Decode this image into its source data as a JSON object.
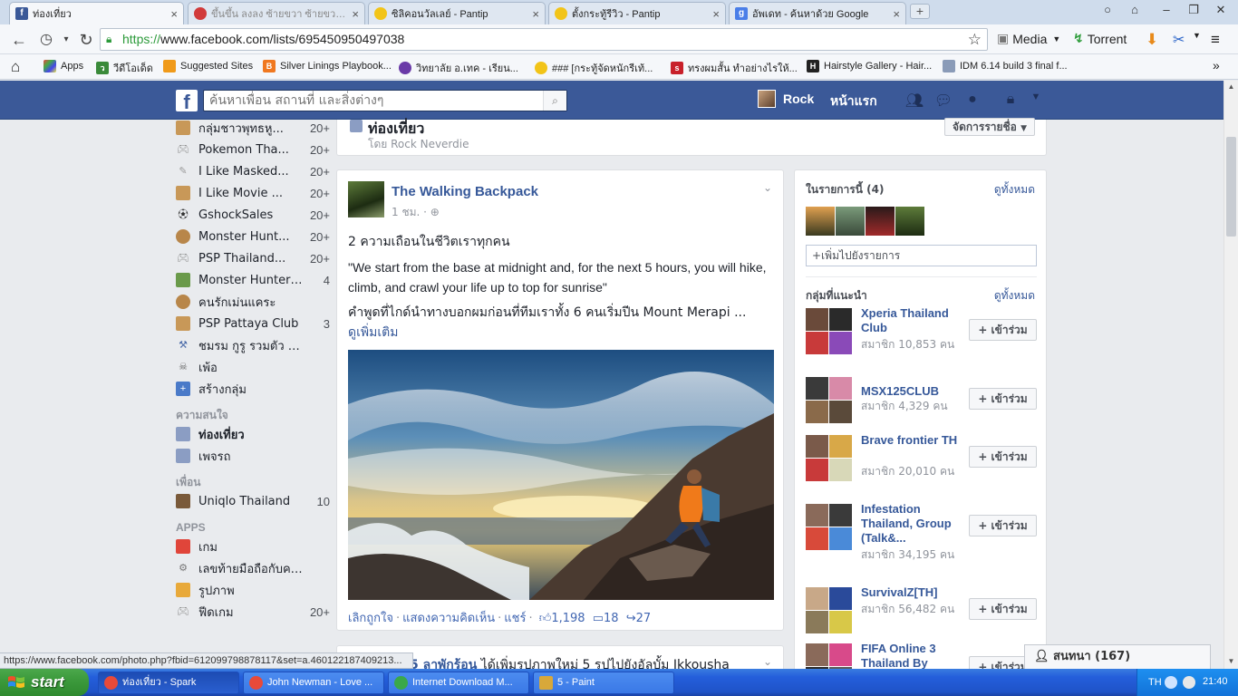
{
  "browser": {
    "tabs": [
      {
        "title": "ท่องเที่ยว",
        "active": true
      },
      {
        "title": "ขึ้นขึ้น ลงลง ซ้ายขวา ซ้ายขวา C",
        "active": false
      },
      {
        "title": "ซิลิคอนวัลเลย์ - Pantip",
        "active": false
      },
      {
        "title": "ตั้งกระทู้รีวิว - Pantip",
        "active": false
      },
      {
        "title": "อัพเดท - ค้นหาด้วย Google",
        "active": false
      }
    ],
    "url_scheme": "https://",
    "url_rest": "www.facebook.com/lists/695450950497038",
    "extensions": {
      "media": "Media",
      "torrent": "Torrent"
    },
    "bookmarks": [
      "Apps",
      "วีดีโอเด็ด",
      "Suggested Sites",
      "Silver Linings Playbook...",
      "วิทยาลัย อ.เทค - เรียน...",
      "### [กระทู้จัดหนักรีเท้...",
      "ทรงผมสั้น ทำอย่างไรให้...",
      "Hairstyle Gallery - Hair...",
      "IDM 6.14 build 3 final f..."
    ]
  },
  "fb_header": {
    "search_placeholder": "ค้นหาเพื่อน สถานที่ และสิ่งต่างๆ",
    "user_name": "Rock",
    "home_label": "หน้าแรก"
  },
  "sidebar": {
    "groups": [
      {
        "label": "กลุ่มชาวพุทธหู...",
        "count": "20+"
      },
      {
        "label": "Pokemon Tha...",
        "count": "20+"
      },
      {
        "label": "I Like Masked...",
        "count": "20+"
      },
      {
        "label": "I Like Movie ...",
        "count": "20+"
      },
      {
        "label": "GshockSales",
        "count": "20+"
      },
      {
        "label": "Monster Hunt...",
        "count": "20+"
      },
      {
        "label": "PSP Thailand...",
        "count": "20+"
      },
      {
        "label": "Monster Hunter ...",
        "count": "4"
      },
      {
        "label": "คนรักเม่นแคระ",
        "count": ""
      },
      {
        "label": "PSP Pattaya Club",
        "count": "3"
      },
      {
        "label": "ชมรม กูรู รวมตัว ต่อ...",
        "count": ""
      },
      {
        "label": "เพ้อ",
        "count": ""
      },
      {
        "label": "สร้างกลุ่ม",
        "count": ""
      }
    ],
    "interests_heading": "ความสนใจ",
    "interests": [
      {
        "label": "ท่องเที่ยว",
        "count": ""
      },
      {
        "label": "เพจรถ",
        "count": ""
      }
    ],
    "friends_heading": "เพื่อน",
    "friends": [
      {
        "label": "Uniqlo Thailand",
        "count": "10"
      }
    ],
    "apps_heading": "APPS",
    "apps": [
      {
        "label": "เกม",
        "count": ""
      },
      {
        "label": "เลขท้ายมือถือกับคว...",
        "count": ""
      },
      {
        "label": "รูปภาพ",
        "count": ""
      },
      {
        "label": "ฟีดเกม",
        "count": "20+"
      }
    ]
  },
  "list_header": {
    "title": "ท่องเที่ยว",
    "by": "โดย Rock Neverdie",
    "manage_button": "จัดการรายชื่อ"
  },
  "post": {
    "page_name": "The Walking Backpack",
    "time": "1 ชม. ·",
    "line1": "2 ความเถือนในชีวิตเราทุกคน",
    "line2": "\"We start from the base at midnight and, for the next 5 hours, you will hike, climb, and crawl your life up to top for sunrise\"",
    "line3": "คำพูดที่ไกด์นำทางบอกผมก่อนที่ทีมเราทั้ง 6 คนเริ่มปีน Mount Merapi ...",
    "see_more": "ดูเพิ่มเติม",
    "action_unlike": "เลิกถูกใจ",
    "action_comment": "แสดงความคิดเห็น",
    "action_share": "แชร์",
    "likes": "1,198",
    "comments": "18",
    "shares": "27"
  },
  "post2": {
    "title": "5 ลาพักร้อน",
    "text": "ได้เพิ่มรูปภาพใหม่ 5 รูปไปยังอัลบั้ม Ikkousha"
  },
  "right_panel": {
    "members_heading": "ในรายการนี้ (4)",
    "see_all": "ดูทั้งหมด",
    "add_placeholder": "+เพิ่มไปยังรายการ",
    "suggested_heading": "กลุ่มที่แนะนำ",
    "join_label": "+ เข้าร่วม",
    "groups": [
      {
        "name": "Xperia Thailand Club",
        "members": "สมาชิก 10,853 คน"
      },
      {
        "name": "MSX125CLUB",
        "members": "สมาชิก 4,329 คน"
      },
      {
        "name": "Brave frontier TH",
        "members": "สมาชิก 20,010 คน"
      },
      {
        "name": "Infestation Thailand, Group (Talk&...",
        "members": "สมาชิก 34,195 คน"
      },
      {
        "name": "SurvivalZ[TH]",
        "members": "สมาชิก 56,482 คน"
      },
      {
        "name": "FIFA Online 3 Thailand By",
        "members": ""
      }
    ]
  },
  "chat": {
    "label": "สนทนา (167)"
  },
  "status_url": "https://www.facebook.com/photo.php?fbid=612099798878117&set=a.460122187409213...",
  "taskbar": {
    "start": "start",
    "tasks": [
      "ท่องเที่ยว - Spark",
      "John Newman - Love ...",
      "Internet Download M...",
      "5 - Paint"
    ],
    "lang": "TH",
    "clock": "21:40"
  }
}
